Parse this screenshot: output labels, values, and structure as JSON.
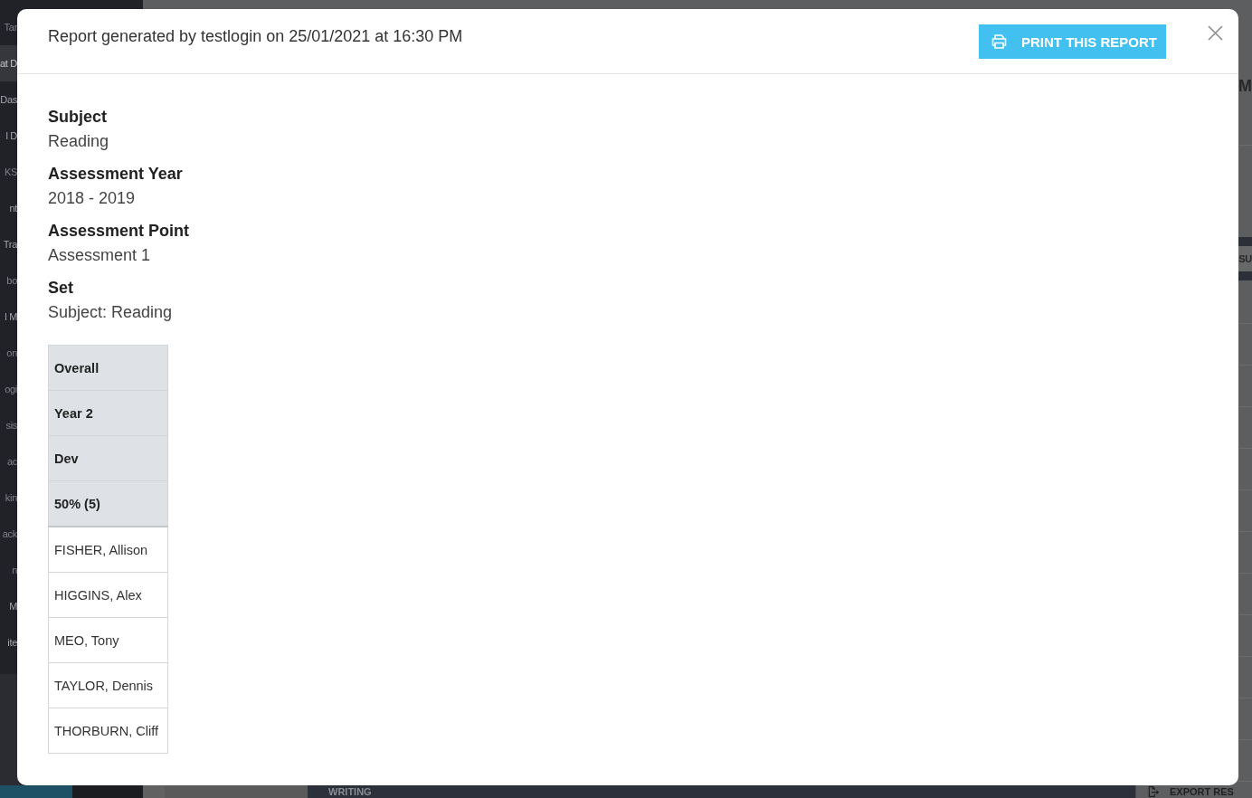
{
  "backdrop": {
    "sidebar": {
      "items": [
        {
          "label": "Tar",
          "selected": false,
          "dimmed": true
        },
        {
          "label": "at D",
          "selected": true,
          "dimmed": false
        },
        {
          "label": "Das",
          "selected": false,
          "dimmed": false
        },
        {
          "label": "l D",
          "selected": false,
          "dimmed": false
        },
        {
          "label": "KS",
          "selected": false,
          "dimmed": true
        },
        {
          "label": "nt",
          "selected": false,
          "dimmed": false
        },
        {
          "label": "Tra",
          "selected": false,
          "dimmed": false
        },
        {
          "label": "bo",
          "selected": false,
          "dimmed": true
        },
        {
          "label": "l M",
          "selected": false,
          "dimmed": false
        },
        {
          "label": "on",
          "selected": false,
          "dimmed": true
        },
        {
          "label": "ogi",
          "selected": false,
          "dimmed": true
        },
        {
          "label": "sis",
          "selected": false,
          "dimmed": true
        },
        {
          "label": "ac",
          "selected": false,
          "dimmed": true
        },
        {
          "label": "kin",
          "selected": false,
          "dimmed": true
        },
        {
          "label": "ack",
          "selected": false,
          "dimmed": true
        },
        {
          "label": "n",
          "selected": false,
          "dimmed": true
        },
        {
          "label": "M",
          "selected": false,
          "dimmed": false
        },
        {
          "label": "ite",
          "selected": false,
          "dimmed": false
        }
      ]
    },
    "page_heading": "M",
    "results_header": "SU",
    "bottom_bar": {
      "tab": "WRITING",
      "export_button": "EXPORT RES"
    }
  },
  "modal": {
    "title": "Report generated by testlogin on 25/01/2021 at 16:30 PM",
    "print_button": "PRINT THIS REPORT",
    "fields": [
      {
        "label": "Subject",
        "value": "Reading"
      },
      {
        "label": "Assessment Year",
        "value": "2018 - 2019"
      },
      {
        "label": "Assessment Point",
        "value": "Assessment 1"
      },
      {
        "label": "Set",
        "value": "Subject: Reading"
      }
    ],
    "table": {
      "header_cells": [
        "Overall",
        "Year 2",
        "Dev",
        "50% (5)"
      ],
      "rows": [
        "FISHER, Allison",
        "HIGGINS, Alex",
        "MEO, Tony",
        "TAYLOR, Dennis",
        "THORBURN, Cliff"
      ]
    }
  }
}
